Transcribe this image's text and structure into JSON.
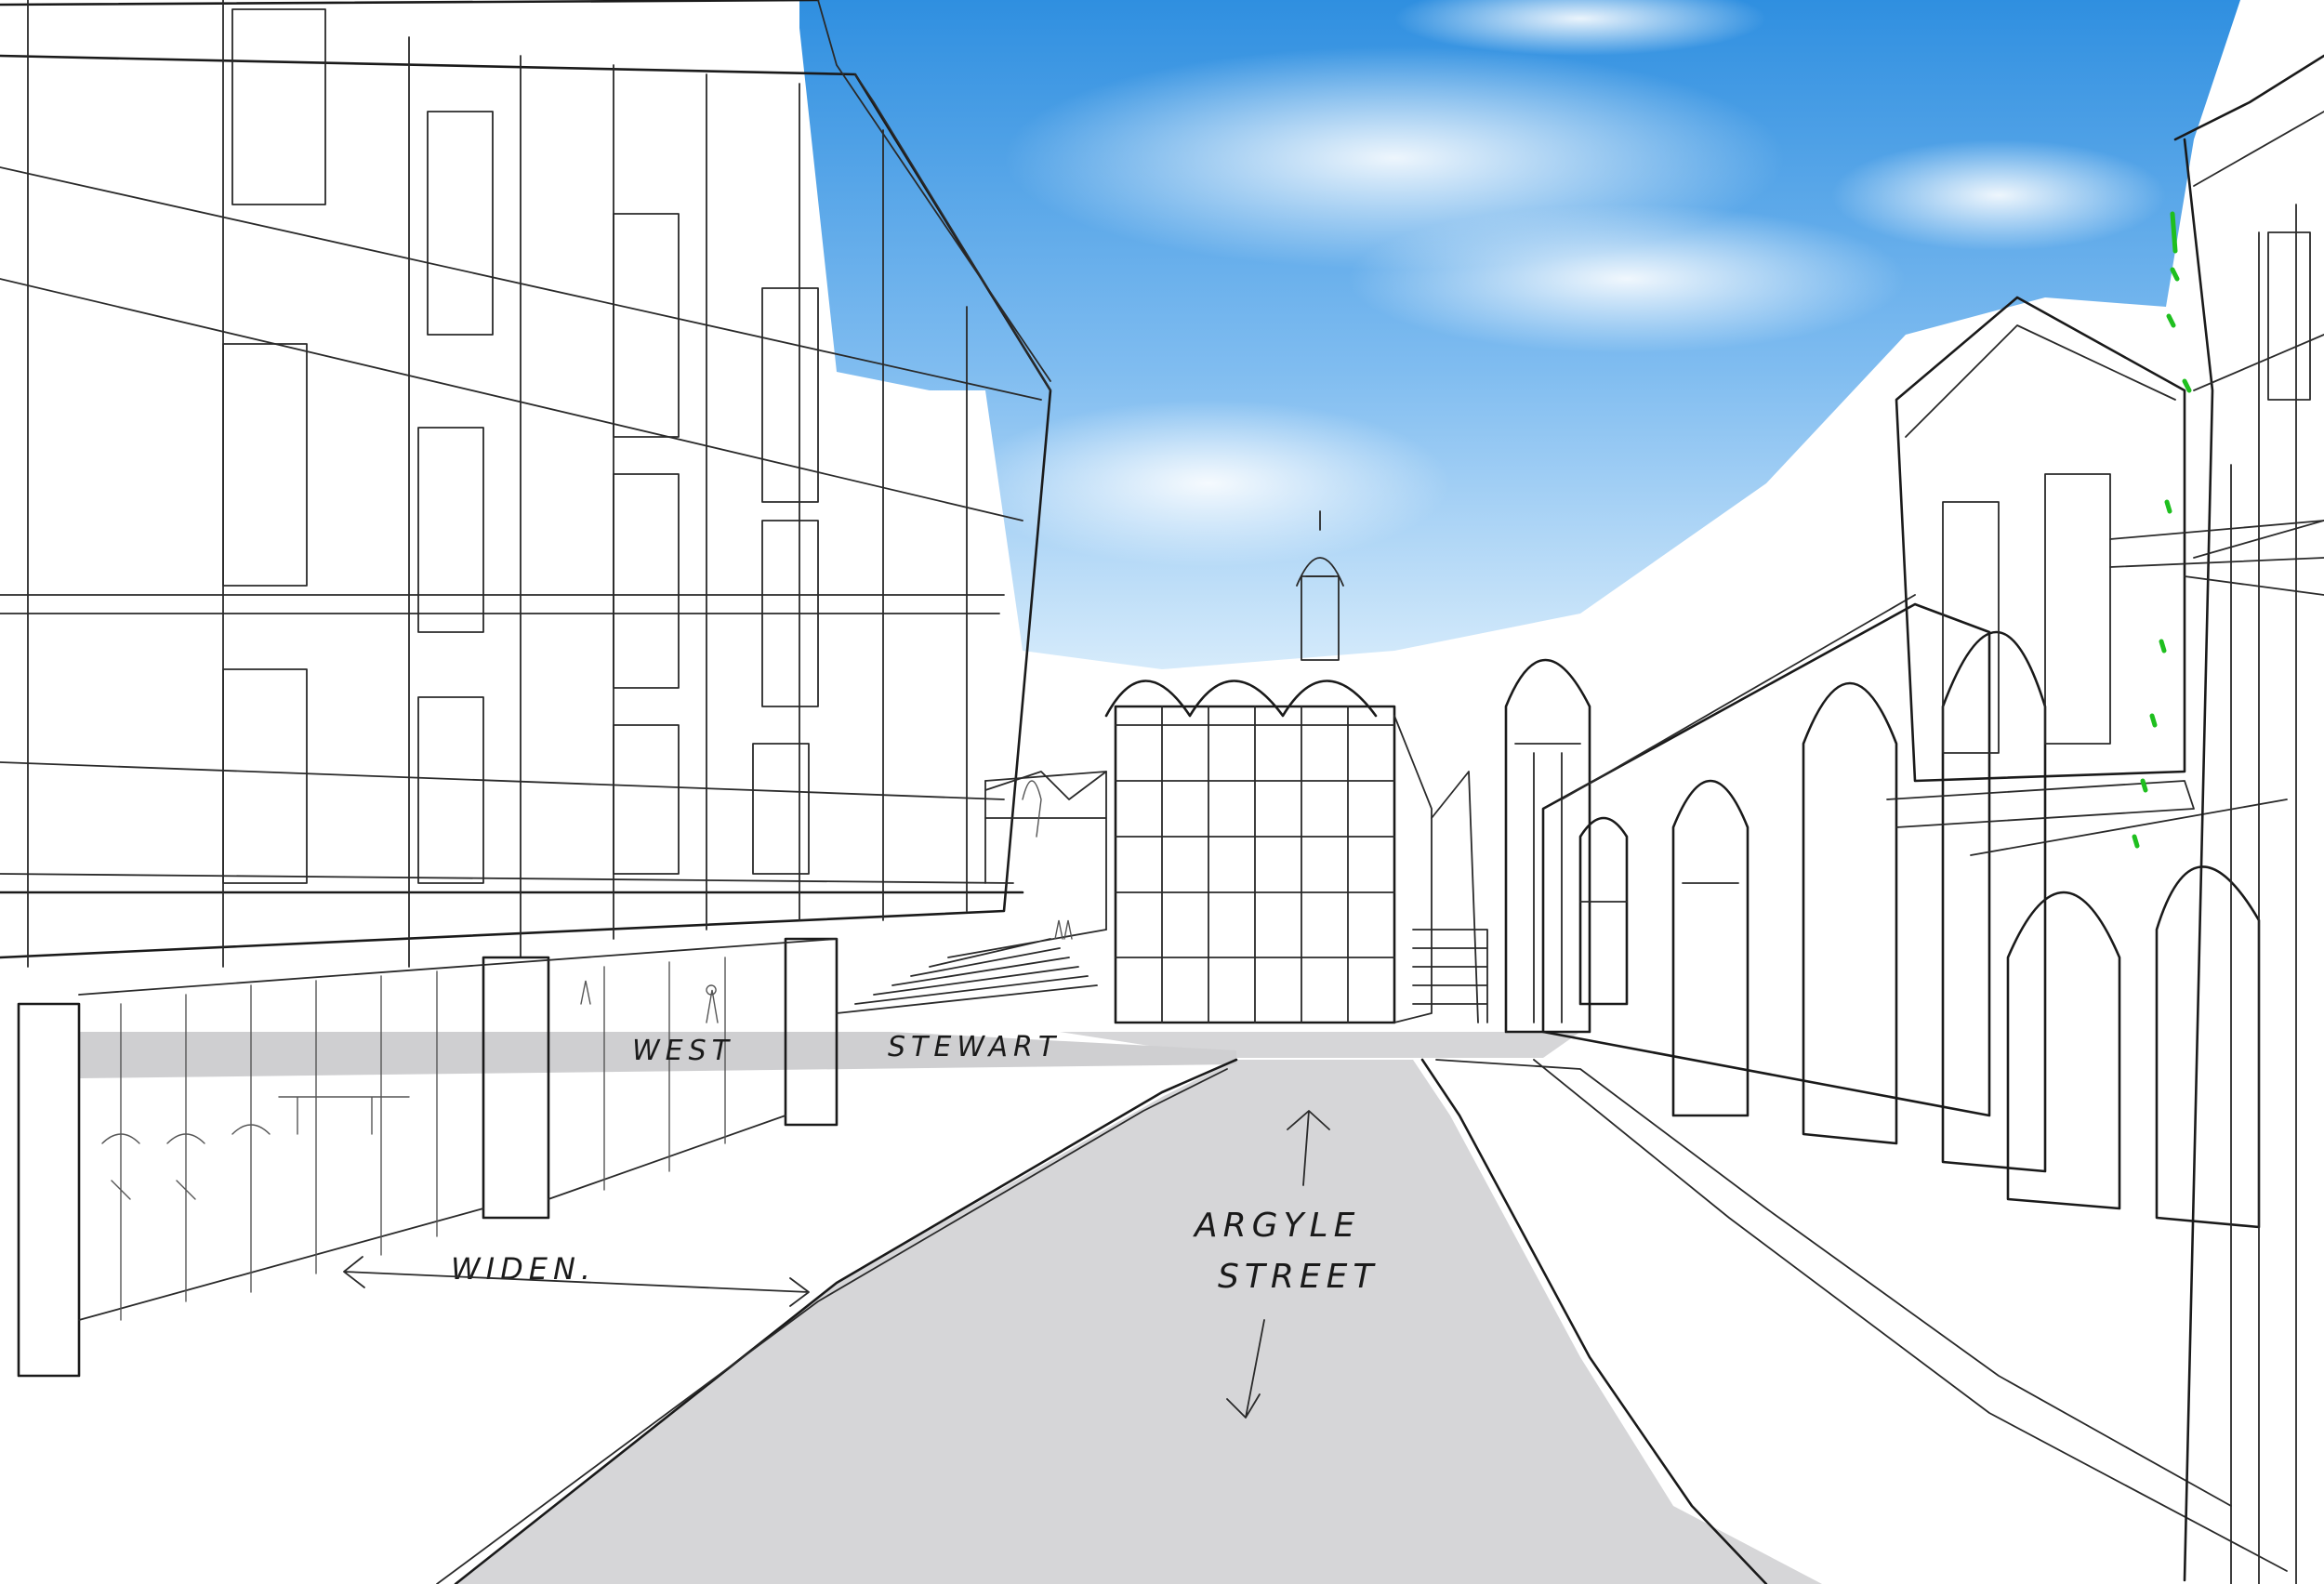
{
  "annotations": {
    "west": "WEST",
    "stewart": "STEWART",
    "argyle": "ARGYLE",
    "street": "STREET",
    "widen": "WIDEN."
  },
  "colors": {
    "sky_top": "#2f8fe0",
    "sky_bottom": "#cfe7fb",
    "road": "#d6d6d8",
    "cross_street": "#cfcfd1",
    "ink": "#1a1a1a",
    "accent_green": "#1fbf1f"
  },
  "icons": {
    "arrow_up": "arrow-up-icon",
    "arrow_down": "arrow-down-icon",
    "double_arrow": "double-arrow-icon"
  }
}
